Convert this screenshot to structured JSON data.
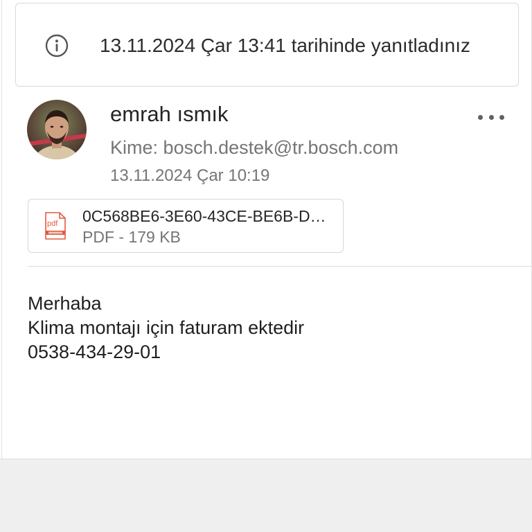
{
  "notice": {
    "icon": "info-icon",
    "text": "13.11.2024 Çar 13:41 tarihinde yanıtladınız"
  },
  "message": {
    "sender_name": "emrah ısmık",
    "avatar": "avatar-photo",
    "recipient_label": "Kime:",
    "recipient_email": "bosch.destek@tr.bosch.com",
    "date": "13.11.2024 Çar 10:19",
    "more_icon": "more-horizontal-icon"
  },
  "attachment": {
    "icon": "pdf-file-icon",
    "icon_text": "pdf",
    "name": "0C568BE6-3E60-43CE-BE6B-D…",
    "type": "PDF",
    "separator": "-",
    "size": "179 KB",
    "icon_color": "#e2583e"
  },
  "body": {
    "lines": [
      "Merhaba",
      "Klima montajı için faturam ektedir",
      "0538-434-29-01"
    ]
  },
  "colors": {
    "text_primary": "#242424",
    "text_secondary": "#757575",
    "border": "#d9d9d9",
    "footer_bg": "#efefef"
  }
}
